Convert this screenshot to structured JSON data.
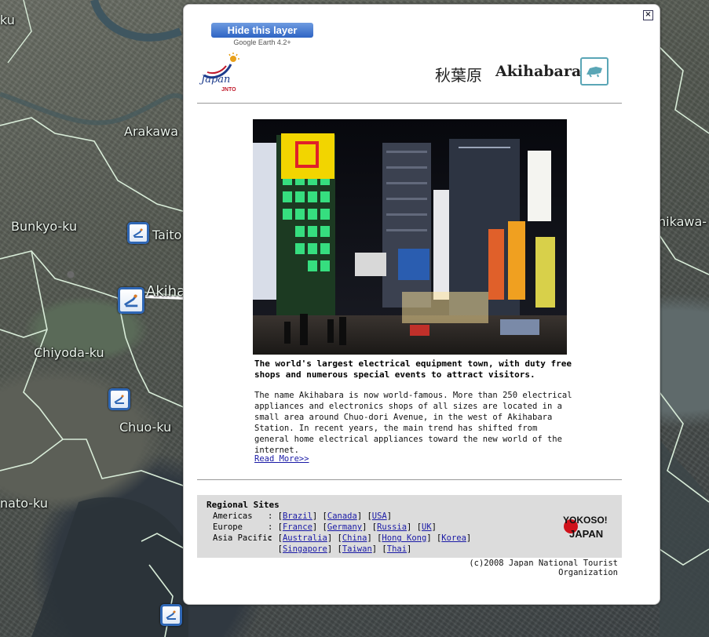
{
  "map": {
    "labels": [
      "Arakawa",
      "Bunkyo-ku",
      "Taito",
      "Akiha",
      "Chiyoda-ku",
      "Chuo-ku",
      "nato-ku",
      "ku",
      "hikawa-"
    ]
  },
  "balloon": {
    "close_symbol": "×",
    "hide_layer": {
      "label": "Hide this layer",
      "sublabel": "Google Earth 4.2+"
    },
    "logo": {
      "word": "Japan",
      "abbr": "JNTO"
    },
    "title_jp": "秋葉原",
    "title_en": "Akihabara",
    "headline": "The world's largest electrical equipment town, with duty free shops and numerous special events to attract visitors.",
    "body": "The name Akihabara is now world-famous. More than 250 electrical appliances and electronics shops of all sizes are located in a small area around Chuo-dori Avenue, in the west of Akihabara Station. In recent years, the main trend has shifted from general home electrical appliances toward the new world of the internet.",
    "read_more": "Read More>>",
    "regional": {
      "title": "Regional Sites",
      "americas_label": "Americas",
      "europe_label": "Europe",
      "asia_label": "Asia Pacific",
      "americas": [
        "Brazil",
        "Canada",
        "USA"
      ],
      "europe": [
        "France",
        "Germany",
        "Russia",
        "UK"
      ],
      "asia_row1": [
        "Australia",
        "China",
        "Hong Kong",
        "Korea"
      ],
      "asia_row2": [
        "Singapore",
        "Taiwan",
        "Thai"
      ],
      "yokoso_text": "YOKOSO! JAPAN"
    },
    "copyright": "(c)2008 Japan National Tourist Organization"
  },
  "colors": {
    "hide_button": "#2e64c4",
    "link": "#1a1aa6",
    "regional_bg": "#dcdcdc",
    "pin_border": "#2f67b5"
  }
}
